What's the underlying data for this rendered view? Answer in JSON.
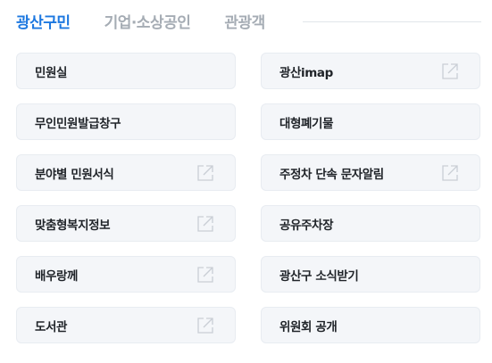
{
  "tabs": [
    {
      "label": "광산구민",
      "active": true
    },
    {
      "label": "기업·소상공인",
      "active": false
    },
    {
      "label": "관광객",
      "active": false
    }
  ],
  "items": [
    {
      "label": "민원실",
      "external": false
    },
    {
      "label": "광산imap",
      "external": true
    },
    {
      "label": "무인민원발급창구",
      "external": false
    },
    {
      "label": "대형폐기물",
      "external": false
    },
    {
      "label": "분야별 민원서식",
      "external": true
    },
    {
      "label": "주정차 단속 문자알림",
      "external": true
    },
    {
      "label": "맞춤형복지정보",
      "external": true
    },
    {
      "label": "공유주차장",
      "external": false
    },
    {
      "label": "배우랑께",
      "external": true
    },
    {
      "label": "광산구 소식받기",
      "external": false
    },
    {
      "label": "도서관",
      "external": true
    },
    {
      "label": "위원회 공개",
      "external": false
    }
  ],
  "colors": {
    "active_tab": "#1d78e0",
    "inactive_tab": "#a5acb4",
    "item_bg": "#f4f6f9",
    "icon_stroke": "#c9ced5"
  },
  "icons": {
    "external": "external-link-icon"
  }
}
